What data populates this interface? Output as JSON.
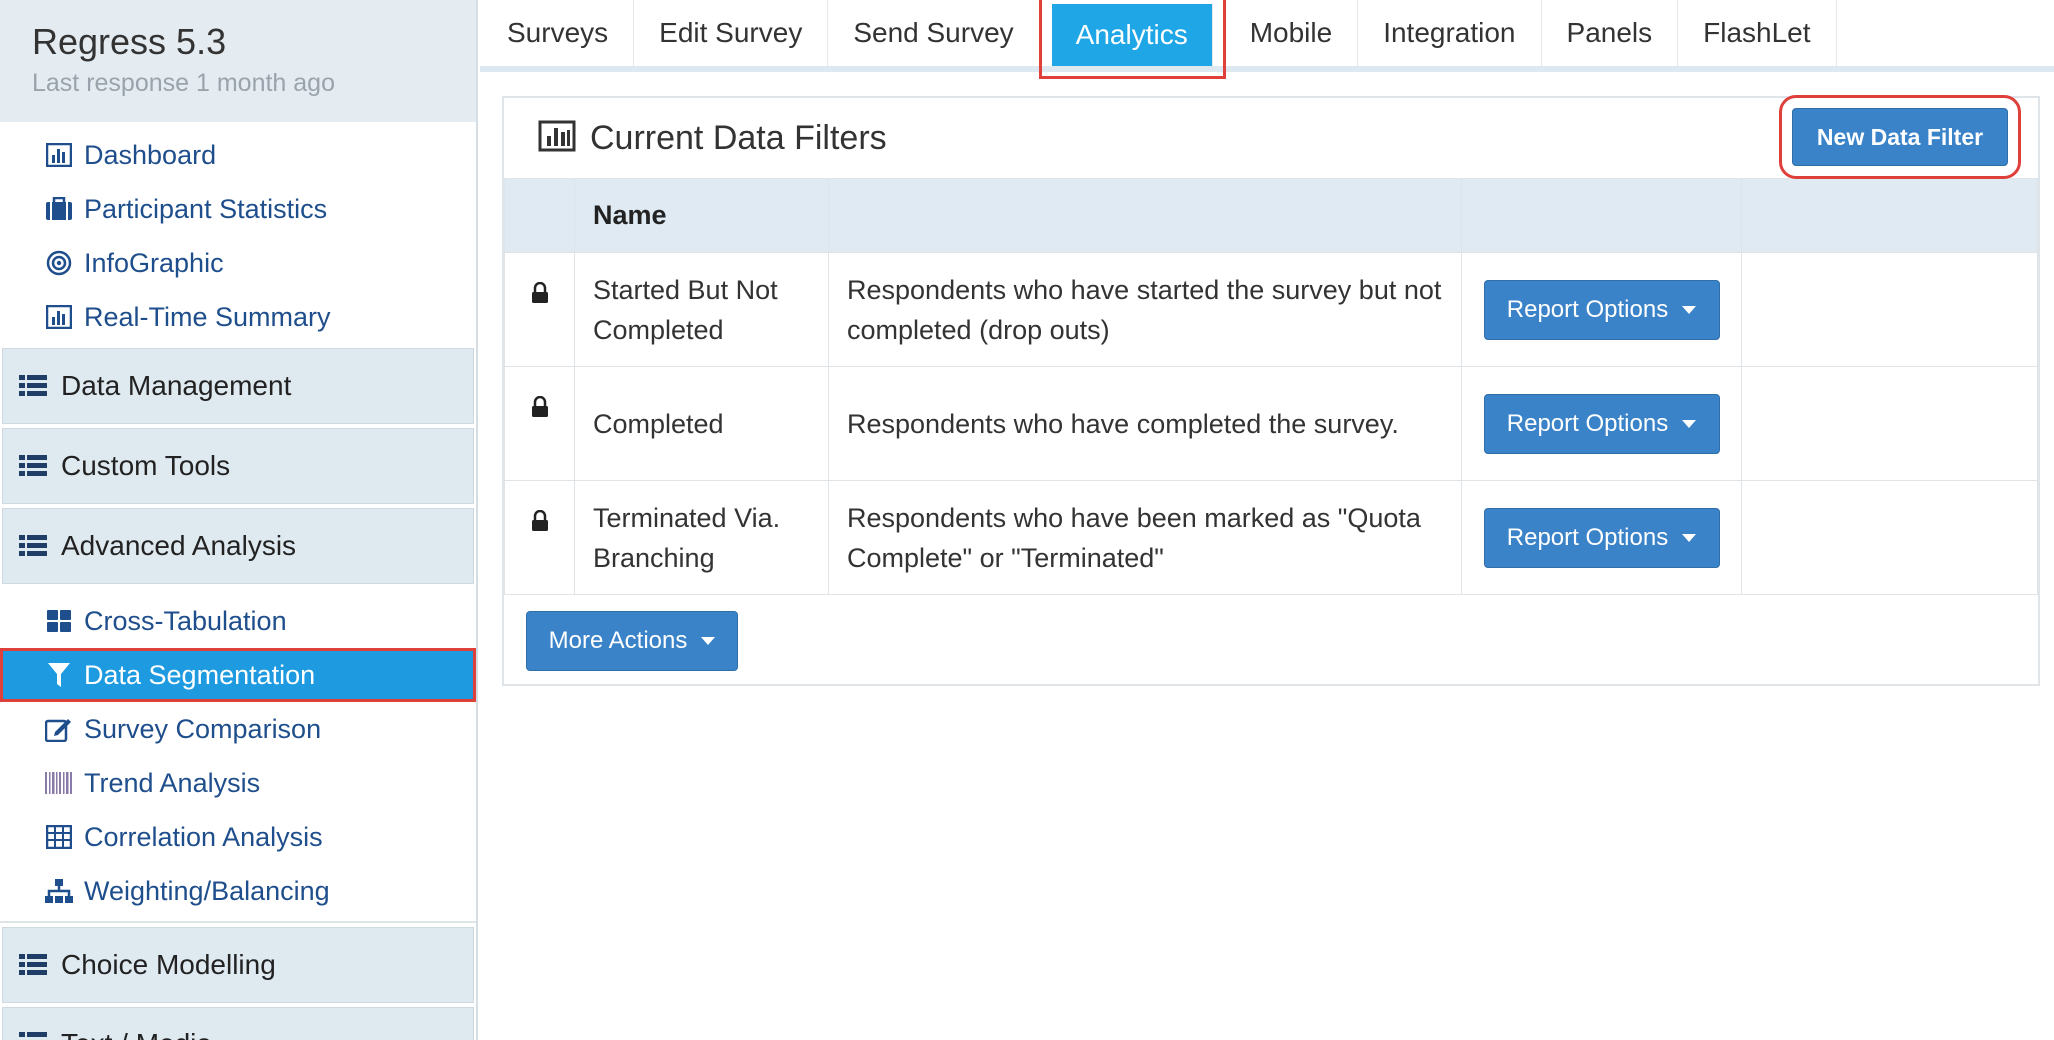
{
  "app": {
    "title": "Regress 5.3",
    "subtitle": "Last response 1 month ago"
  },
  "sidebar": {
    "top_items": [
      {
        "label": "Dashboard",
        "icon": "bar-chart-icon"
      },
      {
        "label": "Participant Statistics",
        "icon": "briefcase-icon"
      },
      {
        "label": "InfoGraphic",
        "icon": "target-icon"
      },
      {
        "label": "Real-Time Summary",
        "icon": "bar-chart-icon"
      }
    ],
    "sections": [
      {
        "label": "Data Management",
        "icon": "list-icon"
      },
      {
        "label": "Custom Tools",
        "icon": "list-icon"
      },
      {
        "label": "Advanced Analysis",
        "icon": "list-icon"
      }
    ],
    "analysis_items": [
      {
        "label": "Cross-Tabulation",
        "icon": "grid-icon",
        "active": false
      },
      {
        "label": "Data Segmentation",
        "icon": "filter-icon",
        "active": true
      },
      {
        "label": "Survey Comparison",
        "icon": "edit-icon",
        "active": false
      },
      {
        "label": "Trend Analysis",
        "icon": "barcode-icon",
        "active": false
      },
      {
        "label": "Correlation Analysis",
        "icon": "table-icon",
        "active": false
      },
      {
        "label": "Weighting/Balancing",
        "icon": "sitemap-icon",
        "active": false
      }
    ],
    "bottom_sections": [
      {
        "label": "Choice Modelling",
        "icon": "list-icon"
      },
      {
        "label": "Text / Media",
        "icon": "list-icon"
      }
    ]
  },
  "tabs": [
    {
      "label": "Surveys",
      "active": false
    },
    {
      "label": "Edit Survey",
      "active": false
    },
    {
      "label": "Send Survey",
      "active": false
    },
    {
      "label": "Analytics",
      "active": true
    },
    {
      "label": "Mobile",
      "active": false
    },
    {
      "label": "Integration",
      "active": false
    },
    {
      "label": "Panels",
      "active": false
    },
    {
      "label": "FlashLet",
      "active": false
    }
  ],
  "panel": {
    "title": "Current Data Filters",
    "new_button": "New Data Filter",
    "column_name": "Name",
    "rows": [
      {
        "name": "Started But Not Completed",
        "description": "Respondents who have started the survey but not completed (drop outs)",
        "button": "Report Options"
      },
      {
        "name": "Completed",
        "description": "Respondents who have completed the survey.",
        "button": "Report Options"
      },
      {
        "name": "Terminated Via. Branching",
        "description": "Respondents who have been marked as \"Quota Complete\" or \"Terminated\"",
        "button": "Report Options"
      }
    ],
    "more_actions": "More Actions"
  },
  "colors": {
    "accent": "#1ea6e6",
    "button": "#3a83c9",
    "highlight": "#e0403a",
    "link": "#1f4e8c"
  }
}
